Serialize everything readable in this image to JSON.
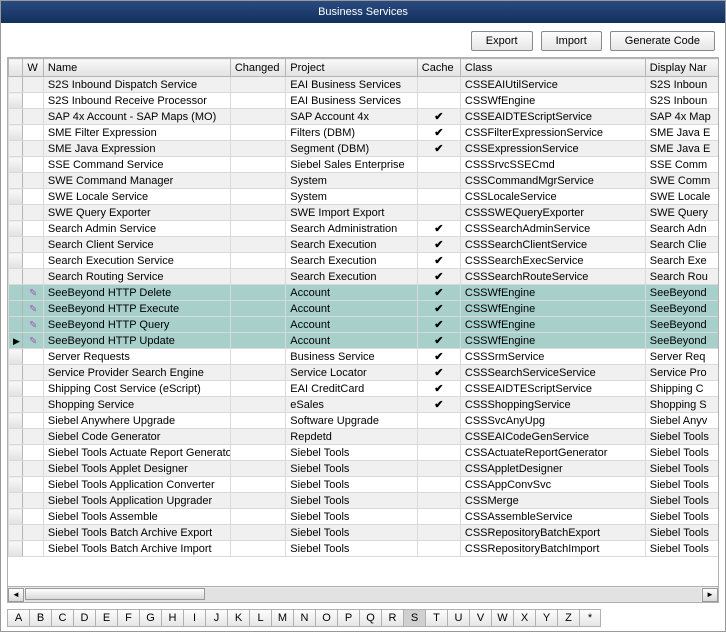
{
  "title": "Business Services",
  "toolbar": {
    "export_label": "Export",
    "import_label": "Import",
    "generate_label": "Generate Code"
  },
  "columns": {
    "w": "W",
    "name": "Name",
    "changed": "Changed",
    "project": "Project",
    "cache": "Cache",
    "class": "Class",
    "display_name": "Display Nar"
  },
  "rows": [
    {
      "w": "",
      "name": "S2S Inbound Dispatch Service",
      "changed": "",
      "project": "EAI Business Services",
      "cache": "",
      "class": "CSSEAIUtilService",
      "disp": "S2S Inboun",
      "hl": false,
      "cur": false
    },
    {
      "w": "",
      "name": "S2S Inbound Receive Processor",
      "changed": "",
      "project": "EAI Business Services",
      "cache": "",
      "class": "CSSWfEngine",
      "disp": "S2S Inboun",
      "hl": false,
      "cur": false
    },
    {
      "w": "",
      "name": "SAP 4x Account - SAP Maps (MO)",
      "changed": "",
      "project": "SAP Account 4x",
      "cache": "✔",
      "class": "CSSEAIDTEScriptService",
      "disp": "SAP 4x Map",
      "hl": false,
      "cur": false
    },
    {
      "w": "",
      "name": "SME Filter Expression",
      "changed": "",
      "project": "Filters (DBM)",
      "cache": "✔",
      "class": "CSSFilterExpressionService",
      "disp": "SME Java E",
      "hl": false,
      "cur": false
    },
    {
      "w": "",
      "name": "SME Java Expression",
      "changed": "",
      "project": "Segment (DBM)",
      "cache": "✔",
      "class": "CSSExpressionService",
      "disp": "SME Java E",
      "hl": false,
      "cur": false
    },
    {
      "w": "",
      "name": "SSE Command Service",
      "changed": "",
      "project": "Siebel Sales Enterprise",
      "cache": "",
      "class": "CSSSrvcSSECmd",
      "disp": "SSE Comm",
      "hl": false,
      "cur": false
    },
    {
      "w": "",
      "name": "SWE Command Manager",
      "changed": "",
      "project": "System",
      "cache": "",
      "class": "CSSCommandMgrService",
      "disp": "SWE Comm",
      "hl": false,
      "cur": false
    },
    {
      "w": "",
      "name": "SWE Locale Service",
      "changed": "",
      "project": "System",
      "cache": "",
      "class": "CSSLocaleService",
      "disp": "SWE Locale",
      "hl": false,
      "cur": false
    },
    {
      "w": "",
      "name": "SWE Query Exporter",
      "changed": "",
      "project": "SWE Import Export",
      "cache": "",
      "class": "CSSSWEQueryExporter",
      "disp": "SWE Query",
      "hl": false,
      "cur": false
    },
    {
      "w": "",
      "name": "Search Admin Service",
      "changed": "",
      "project": "Search Administration",
      "cache": "✔",
      "class": "CSSSearchAdminService",
      "disp": "Search Adn",
      "hl": false,
      "cur": false
    },
    {
      "w": "",
      "name": "Search Client Service",
      "changed": "",
      "project": "Search Execution",
      "cache": "✔",
      "class": "CSSSearchClientService",
      "disp": "Search Clie",
      "hl": false,
      "cur": false
    },
    {
      "w": "",
      "name": "Search Execution Service",
      "changed": "",
      "project": "Search Execution",
      "cache": "✔",
      "class": "CSSSearchExecService",
      "disp": "Search Exe",
      "hl": false,
      "cur": false
    },
    {
      "w": "",
      "name": "Search Routing Service",
      "changed": "",
      "project": "Search Execution",
      "cache": "✔",
      "class": "CSSSearchRouteService",
      "disp": "Search Rou",
      "hl": false,
      "cur": false
    },
    {
      "w": "✎",
      "name": "SeeBeyond HTTP Delete",
      "changed": "",
      "project": "Account",
      "cache": "✔",
      "class": "CSSWfEngine",
      "disp": "SeeBeyond",
      "hl": true,
      "cur": false
    },
    {
      "w": "✎",
      "name": "SeeBeyond HTTP Execute",
      "changed": "",
      "project": "Account",
      "cache": "✔",
      "class": "CSSWfEngine",
      "disp": "SeeBeyond",
      "hl": true,
      "cur": false
    },
    {
      "w": "✎",
      "name": "SeeBeyond HTTP Query",
      "changed": "",
      "project": "Account",
      "cache": "✔",
      "class": "CSSWfEngine",
      "disp": "SeeBeyond",
      "hl": true,
      "cur": false
    },
    {
      "w": "✎",
      "name": "SeeBeyond HTTP Update",
      "changed": "",
      "project": "Account",
      "cache": "✔",
      "class": "CSSWfEngine",
      "disp": "SeeBeyond",
      "hl": true,
      "cur": true
    },
    {
      "w": "",
      "name": "Server Requests",
      "changed": "",
      "project": "Business Service",
      "cache": "✔",
      "class": "CSSSrmService",
      "disp": "Server Req",
      "hl": false,
      "cur": false
    },
    {
      "w": "",
      "name": "Service Provider Search Engine",
      "changed": "",
      "project": "Service Locator",
      "cache": "✔",
      "class": "CSSSearchServiceService",
      "disp": "Service Pro",
      "hl": false,
      "cur": false
    },
    {
      "w": "",
      "name": "Shipping Cost Service (eScript)",
      "changed": "",
      "project": "EAI CreditCard",
      "cache": "✔",
      "class": "CSSEAIDTEScriptService",
      "disp": "Shipping C",
      "hl": false,
      "cur": false
    },
    {
      "w": "",
      "name": "Shopping Service",
      "changed": "",
      "project": "eSales",
      "cache": "✔",
      "class": "CSSShoppingService",
      "disp": "Shopping S",
      "hl": false,
      "cur": false
    },
    {
      "w": "",
      "name": "Siebel Anywhere Upgrade",
      "changed": "",
      "project": "Software Upgrade",
      "cache": "",
      "class": "CSSSvcAnyUpg",
      "disp": "Siebel Anyv",
      "hl": false,
      "cur": false
    },
    {
      "w": "",
      "name": "Siebel Code Generator",
      "changed": "",
      "project": "Repdetd",
      "cache": "",
      "class": "CSSEAICodeGenService",
      "disp": "Siebel Tools",
      "hl": false,
      "cur": false
    },
    {
      "w": "",
      "name": "Siebel Tools Actuate Report Generator",
      "changed": "",
      "project": "Siebel Tools",
      "cache": "",
      "class": "CSSActuateReportGenerator",
      "disp": "Siebel Tools",
      "hl": false,
      "cur": false
    },
    {
      "w": "",
      "name": "Siebel Tools Applet Designer",
      "changed": "",
      "project": "Siebel Tools",
      "cache": "",
      "class": "CSSAppletDesigner",
      "disp": "Siebel Tools",
      "hl": false,
      "cur": false
    },
    {
      "w": "",
      "name": "Siebel Tools Application Converter",
      "changed": "",
      "project": "Siebel Tools",
      "cache": "",
      "class": "CSSAppConvSvc",
      "disp": "Siebel Tools",
      "hl": false,
      "cur": false
    },
    {
      "w": "",
      "name": "Siebel Tools Application Upgrader",
      "changed": "",
      "project": "Siebel Tools",
      "cache": "",
      "class": "CSSMerge",
      "disp": "Siebel Tools",
      "hl": false,
      "cur": false
    },
    {
      "w": "",
      "name": "Siebel Tools Assemble",
      "changed": "",
      "project": "Siebel Tools",
      "cache": "",
      "class": "CSSAssembleService",
      "disp": "Siebel Tools",
      "hl": false,
      "cur": false
    },
    {
      "w": "",
      "name": "Siebel Tools Batch Archive Export",
      "changed": "",
      "project": "Siebel Tools",
      "cache": "",
      "class": "CSSRepositoryBatchExport",
      "disp": "Siebel Tools",
      "hl": false,
      "cur": false
    },
    {
      "w": "",
      "name": "Siebel Tools Batch Archive Import",
      "changed": "",
      "project": "Siebel Tools",
      "cache": "",
      "class": "CSSRepositoryBatchImport",
      "disp": "Siebel Tools",
      "hl": false,
      "cur": false
    }
  ],
  "alpha": [
    "A",
    "B",
    "C",
    "D",
    "E",
    "F",
    "G",
    "H",
    "I",
    "J",
    "K",
    "L",
    "M",
    "N",
    "O",
    "P",
    "Q",
    "R",
    "S",
    "T",
    "U",
    "V",
    "W",
    "X",
    "Y",
    "Z",
    "*"
  ],
  "alpha_active": "S"
}
